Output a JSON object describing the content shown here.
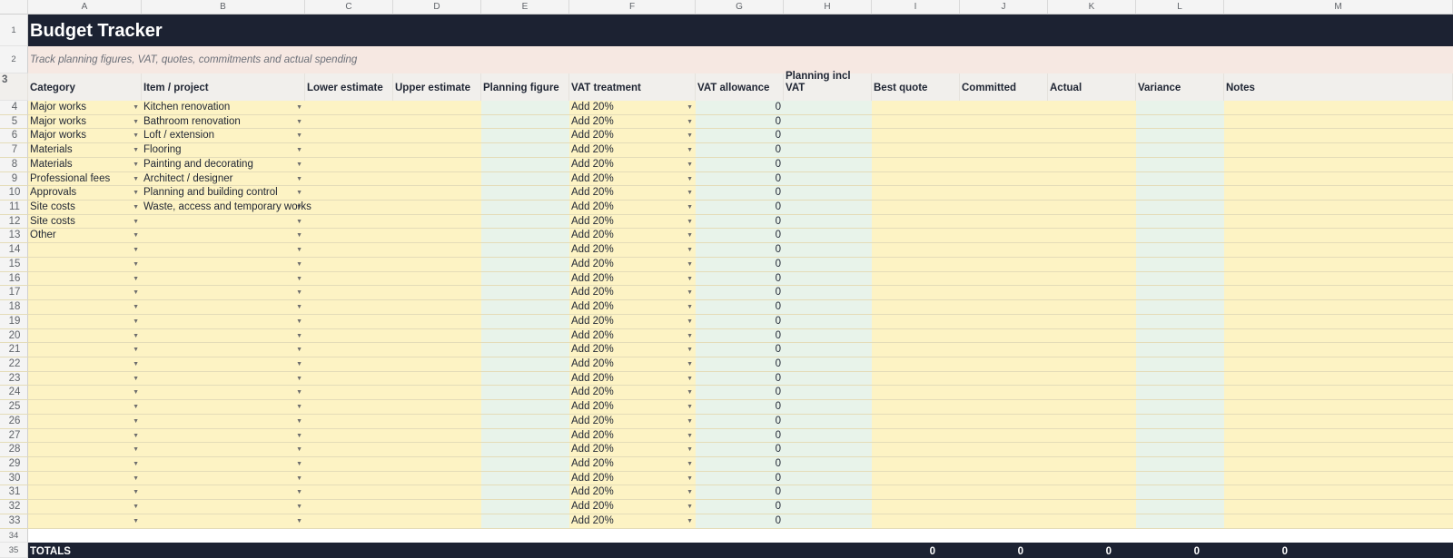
{
  "columns": [
    "A",
    "B",
    "C",
    "D",
    "E",
    "F",
    "G",
    "H",
    "I",
    "J",
    "K",
    "L",
    "M"
  ],
  "title": "Budget Tracker",
  "subtitle": "Track planning figures, VAT, quotes, commitments and actual spending",
  "headers": [
    "Category",
    "Item / project",
    "Lower estimate",
    "Upper estimate",
    "Planning figure",
    "VAT treatment",
    "VAT allowance",
    "Planning incl VAT",
    "Best quote",
    "Committed",
    "Actual",
    "Variance",
    "Notes"
  ],
  "row_numbers": [
    "1",
    "2",
    "3",
    "4",
    "5",
    "6",
    "7",
    "8",
    "9",
    "10",
    "11",
    "12",
    "13",
    "14",
    "15",
    "16",
    "17",
    "18",
    "19",
    "20",
    "21",
    "22",
    "23",
    "24",
    "25",
    "26",
    "27",
    "28",
    "29",
    "30",
    "31",
    "32",
    "33",
    "34",
    "35"
  ],
  "rows": [
    {
      "category": "Major works",
      "item": "Kitchen renovation",
      "vat_treatment": "Add 20%",
      "vat_allowance": "0"
    },
    {
      "category": "Major works",
      "item": "Bathroom renovation",
      "vat_treatment": "Add 20%",
      "vat_allowance": "0"
    },
    {
      "category": "Major works",
      "item": "Loft / extension",
      "vat_treatment": "Add 20%",
      "vat_allowance": "0"
    },
    {
      "category": "Materials",
      "item": "Flooring",
      "vat_treatment": "Add 20%",
      "vat_allowance": "0"
    },
    {
      "category": "Materials",
      "item": "Painting and decorating",
      "vat_treatment": "Add 20%",
      "vat_allowance": "0"
    },
    {
      "category": "Professional fees",
      "item": "Architect / designer",
      "vat_treatment": "Add 20%",
      "vat_allowance": "0"
    },
    {
      "category": "Approvals",
      "item": "Planning and building control",
      "vat_treatment": "Add 20%",
      "vat_allowance": "0"
    },
    {
      "category": "Site costs",
      "item": "Waste, access and temporary works",
      "vat_treatment": "Add 20%",
      "vat_allowance": "0"
    },
    {
      "category": "Site costs",
      "item": "",
      "vat_treatment": "Add 20%",
      "vat_allowance": "0"
    },
    {
      "category": "Other",
      "item": "",
      "vat_treatment": "Add 20%",
      "vat_allowance": "0"
    },
    {
      "category": "",
      "item": "",
      "vat_treatment": "Add 20%",
      "vat_allowance": "0"
    },
    {
      "category": "",
      "item": "",
      "vat_treatment": "Add 20%",
      "vat_allowance": "0"
    },
    {
      "category": "",
      "item": "",
      "vat_treatment": "Add 20%",
      "vat_allowance": "0"
    },
    {
      "category": "",
      "item": "",
      "vat_treatment": "Add 20%",
      "vat_allowance": "0"
    },
    {
      "category": "",
      "item": "",
      "vat_treatment": "Add 20%",
      "vat_allowance": "0"
    },
    {
      "category": "",
      "item": "",
      "vat_treatment": "Add 20%",
      "vat_allowance": "0"
    },
    {
      "category": "",
      "item": "",
      "vat_treatment": "Add 20%",
      "vat_allowance": "0"
    },
    {
      "category": "",
      "item": "",
      "vat_treatment": "Add 20%",
      "vat_allowance": "0"
    },
    {
      "category": "",
      "item": "",
      "vat_treatment": "Add 20%",
      "vat_allowance": "0"
    },
    {
      "category": "",
      "item": "",
      "vat_treatment": "Add 20%",
      "vat_allowance": "0"
    },
    {
      "category": "",
      "item": "",
      "vat_treatment": "Add 20%",
      "vat_allowance": "0"
    },
    {
      "category": "",
      "item": "",
      "vat_treatment": "Add 20%",
      "vat_allowance": "0"
    },
    {
      "category": "",
      "item": "",
      "vat_treatment": "Add 20%",
      "vat_allowance": "0"
    },
    {
      "category": "",
      "item": "",
      "vat_treatment": "Add 20%",
      "vat_allowance": "0"
    },
    {
      "category": "",
      "item": "",
      "vat_treatment": "Add 20%",
      "vat_allowance": "0"
    },
    {
      "category": "",
      "item": "",
      "vat_treatment": "Add 20%",
      "vat_allowance": "0"
    },
    {
      "category": "",
      "item": "",
      "vat_treatment": "Add 20%",
      "vat_allowance": "0"
    },
    {
      "category": "",
      "item": "",
      "vat_treatment": "Add 20%",
      "vat_allowance": "0"
    },
    {
      "category": "",
      "item": "",
      "vat_treatment": "Add 20%",
      "vat_allowance": "0"
    },
    {
      "category": "",
      "item": "",
      "vat_treatment": "Add 20%",
      "vat_allowance": "0"
    }
  ],
  "totals": {
    "label": "TOTALS",
    "best_quote_total": "0",
    "committed_total": "0",
    "actual_total": "0",
    "variance_total": "0",
    "notes_total": "0"
  },
  "colors": {
    "title_bg": "#1c2232",
    "subtitle_bg": "#f6e8e2",
    "header_bg": "#f1efec",
    "input_yellow": "#fdf3c4",
    "calc_green": "#e8f3ea"
  },
  "icons": {
    "dropdown": "dropdown-arrow-icon"
  }
}
